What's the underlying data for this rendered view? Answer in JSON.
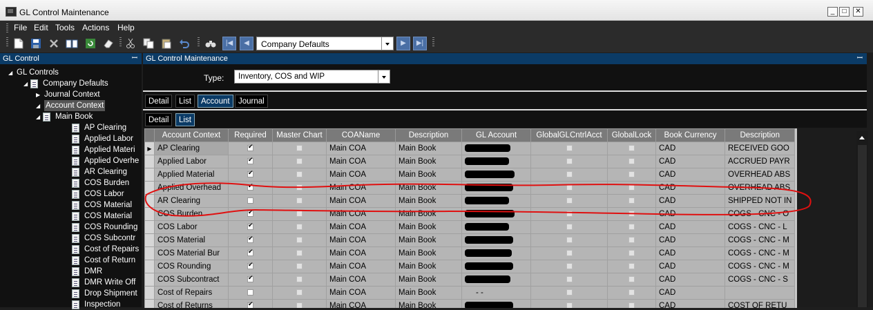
{
  "window": {
    "title": "GL Control Maintenance"
  },
  "menu": [
    "File",
    "Edit",
    "Tools",
    "Actions",
    "Help"
  ],
  "toolbar": {
    "record_combo_value": "Company Defaults"
  },
  "left_panel": {
    "title": "GL Control",
    "tree": [
      {
        "label": "GL Controls",
        "level": 0,
        "expand": "open",
        "icon": false
      },
      {
        "label": "Company Defaults",
        "level": 1,
        "expand": "open",
        "icon": true
      },
      {
        "label": "Journal Context",
        "level": 2,
        "expand": "closed",
        "icon": false
      },
      {
        "label": "Account Context",
        "level": 2,
        "expand": "open",
        "icon": false,
        "selected": true
      },
      {
        "label": "Main Book",
        "level": 3,
        "expand": "open",
        "icon": true
      },
      {
        "label": "AP Clearing",
        "level": 4,
        "icon": true
      },
      {
        "label": "Applied Labor",
        "level": 4,
        "icon": true
      },
      {
        "label": "Applied Materi",
        "level": 4,
        "icon": true
      },
      {
        "label": "Applied Overhe",
        "level": 4,
        "icon": true
      },
      {
        "label": "AR Clearing",
        "level": 4,
        "icon": true
      },
      {
        "label": "COS Burden",
        "level": 4,
        "icon": true
      },
      {
        "label": "COS Labor",
        "level": 4,
        "icon": true
      },
      {
        "label": "COS Material",
        "level": 4,
        "icon": true
      },
      {
        "label": "COS Material",
        "level": 4,
        "icon": true
      },
      {
        "label": "COS Rounding",
        "level": 4,
        "icon": true
      },
      {
        "label": "COS Subcontr",
        "level": 4,
        "icon": true
      },
      {
        "label": "Cost of Repairs",
        "level": 4,
        "icon": true
      },
      {
        "label": "Cost of Return",
        "level": 4,
        "icon": true
      },
      {
        "label": "DMR",
        "level": 4,
        "icon": true
      },
      {
        "label": "DMR Write Off",
        "level": 4,
        "icon": true
      },
      {
        "label": "Drop Shipment",
        "level": 4,
        "icon": true
      },
      {
        "label": "Inspection",
        "level": 4,
        "icon": true
      }
    ]
  },
  "right_panel": {
    "title": "GL Control Maintenance",
    "type_label": "Type:",
    "type_value": "Inventory, COS and WIP",
    "tabs_top": [
      "Detail",
      "List",
      "Account",
      "Journal"
    ],
    "tabs_top_active": "Account",
    "tabs_sub": [
      "Detail",
      "List"
    ],
    "tabs_sub_active": "List"
  },
  "grid": {
    "columns": [
      "Account Context",
      "Required",
      "Master Chart",
      "COAName",
      "Description",
      "GL Account",
      "GlobalGLCntrlAcct",
      "GlobalLock",
      "Book Currency",
      "Description"
    ],
    "rows": [
      {
        "ctx": "AP Clearing",
        "required": true,
        "coa": "Main COA",
        "desc": "Main Book",
        "redact_w": 66,
        "cur": "CAD",
        "desc2": "RECEIVED GOO",
        "current": true
      },
      {
        "ctx": "Applied Labor",
        "required": true,
        "coa": "Main COA",
        "desc": "Main Book",
        "redact_w": 64,
        "cur": "CAD",
        "desc2": "ACCRUED PAYR"
      },
      {
        "ctx": "Applied Material",
        "required": true,
        "coa": "Main COA",
        "desc": "Main Book",
        "redact_w": 72,
        "cur": "CAD",
        "desc2": "OVERHEAD ABS"
      },
      {
        "ctx": "Applied Overhead",
        "required": true,
        "coa": "Main COA",
        "desc": "Main Book",
        "redact_w": 70,
        "cur": "CAD",
        "desc2": "OVERHEAD ABS"
      },
      {
        "ctx": "AR Clearing",
        "required": false,
        "coa": "Main COA",
        "desc": "Main Book",
        "redact_w": 64,
        "cur": "CAD",
        "desc2": "SHIPPED NOT IN"
      },
      {
        "ctx": "COS Burden",
        "required": true,
        "coa": "Main COA",
        "desc": "Main Book",
        "redact_w": 72,
        "cur": "CAD",
        "desc2": "COGS - CNC - O"
      },
      {
        "ctx": "COS Labor",
        "required": true,
        "coa": "Main COA",
        "desc": "Main Book",
        "redact_w": 64,
        "cur": "CAD",
        "desc2": "COGS - CNC - L"
      },
      {
        "ctx": "COS Material",
        "required": true,
        "coa": "Main COA",
        "desc": "Main Book",
        "redact_w": 70,
        "cur": "CAD",
        "desc2": "COGS - CNC - M"
      },
      {
        "ctx": "COS Material Bur",
        "required": true,
        "coa": "Main COA",
        "desc": "Main Book",
        "redact_w": 68,
        "cur": "CAD",
        "desc2": "COGS - CNC - M"
      },
      {
        "ctx": "COS Rounding",
        "required": true,
        "coa": "Main COA",
        "desc": "Main Book",
        "redact_w": 70,
        "cur": "CAD",
        "desc2": "COGS - CNC - M"
      },
      {
        "ctx": "COS Subcontract",
        "required": true,
        "coa": "Main COA",
        "desc": "Main Book",
        "redact_w": 66,
        "cur": "CAD",
        "desc2": "COGS - CNC - S"
      },
      {
        "ctx": "Cost of Repairs",
        "required": false,
        "coa": "Main COA",
        "desc": "Main Book",
        "redact_w": 0,
        "gl_text": "- -",
        "cur": "CAD",
        "desc2": ""
      },
      {
        "ctx": "Cost of Returns",
        "required": true,
        "coa": "Main COA",
        "desc": "Main Book",
        "redact_w": 70,
        "cur": "CAD",
        "desc2": "COST OF RETU"
      }
    ]
  },
  "colors": {
    "panel_header": "#0b3b66",
    "annotation": "#e01010",
    "grid_cell": "#b5b5b5",
    "grid_header": "#7a7a7a"
  }
}
